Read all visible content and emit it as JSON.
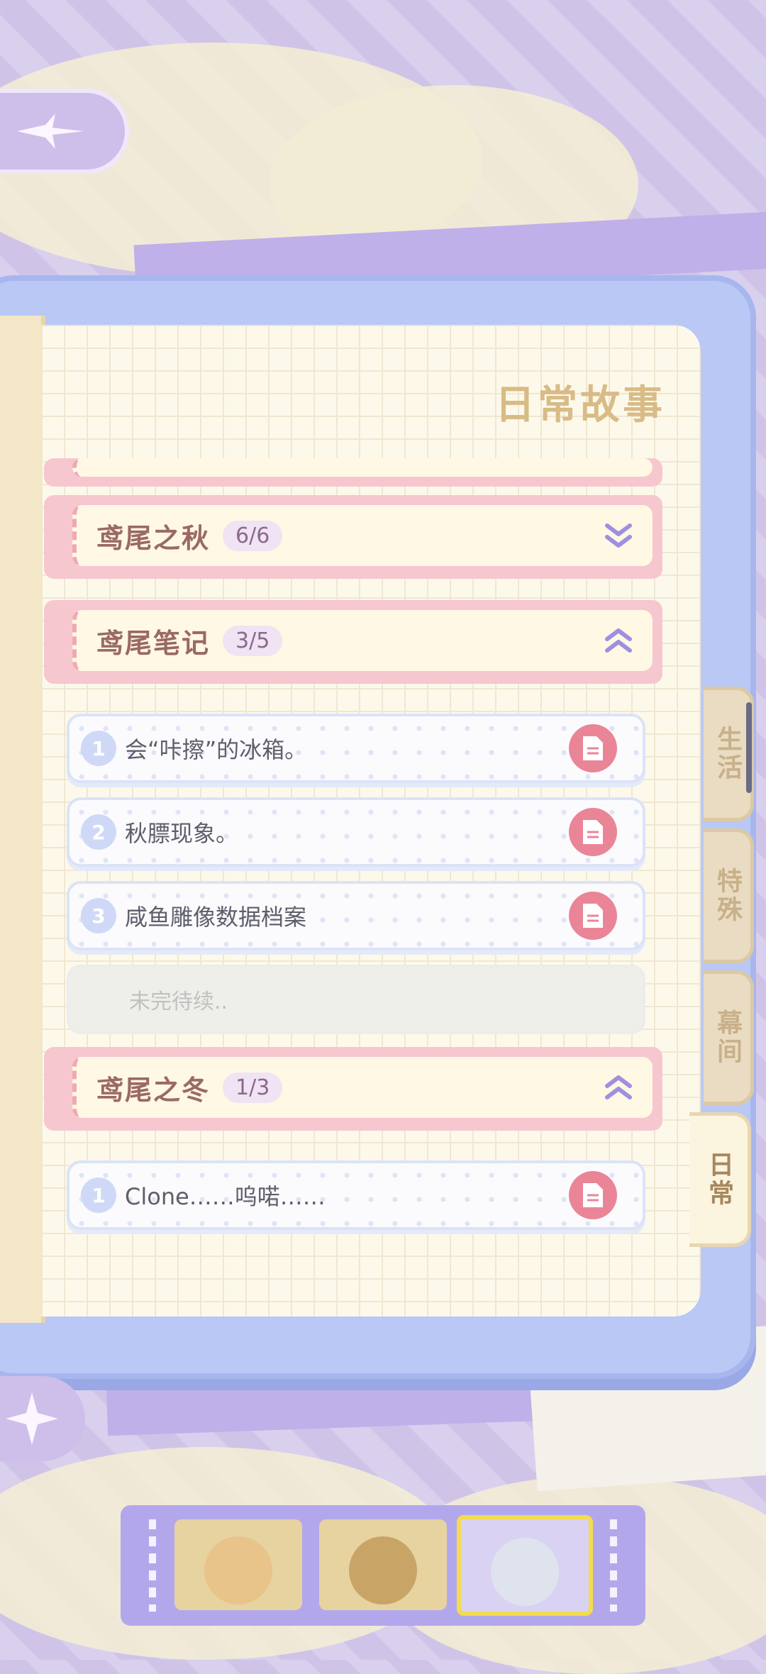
{
  "page_title": "日常故事",
  "chapters": [
    {
      "name": "鸢尾之秋",
      "count": "6/6",
      "state": "collapsed"
    },
    {
      "name": "鸢尾笔记",
      "count": "3/5",
      "state": "expanded",
      "stories": [
        {
          "num": "1",
          "title": "会“咔擦”的冰箱。"
        },
        {
          "num": "2",
          "title": "秋膘现象。"
        },
        {
          "num": "3",
          "title": "咸鱼雕像数据档案"
        }
      ],
      "locked_text": "未完待续.."
    },
    {
      "name": "鸢尾之冬",
      "count": "1/3",
      "state": "expanded",
      "stories": [
        {
          "num": "1",
          "title": "Clone……呜喏……"
        }
      ]
    }
  ],
  "side_tabs": [
    {
      "label": "生活",
      "active": false
    },
    {
      "label": "特殊",
      "active": false
    },
    {
      "label": "幕间",
      "active": false
    },
    {
      "label": "日常",
      "active": true
    }
  ],
  "characters": [
    {
      "name": "char-1",
      "selected": false,
      "color": "#e9c48a"
    },
    {
      "name": "char-2",
      "selected": false,
      "color": "#c9a467"
    },
    {
      "name": "char-3",
      "selected": true,
      "color": "#dfe3ee"
    }
  ],
  "colors": {
    "chapter_accent": "#f6c7ce",
    "doc_button": "#ea8597",
    "chevron": "#9f8fe0"
  }
}
